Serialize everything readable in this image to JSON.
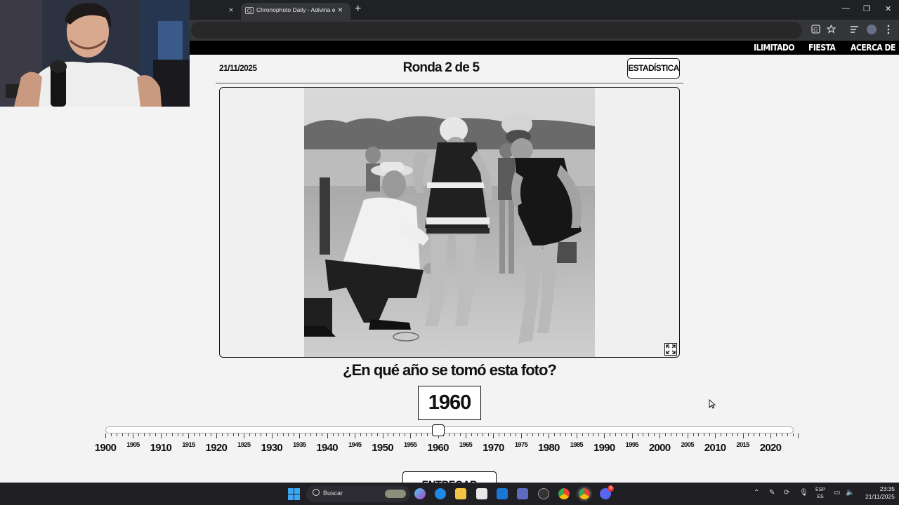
{
  "browser": {
    "tab_title": "Chronophoto Daily - Adivina el año",
    "tab_close": "×",
    "new_tab": "+",
    "window_controls": [
      "—",
      "❐",
      "✕"
    ]
  },
  "nav": {
    "items": [
      "ILIMITADO",
      "FIESTA",
      "ACERCA DE"
    ]
  },
  "header": {
    "date": "21/11/2025",
    "round": "Ronda 2 de 5",
    "stats_button": "ESTADÍSTICA"
  },
  "question": {
    "text": "¿En qué año se tomó esta foto?",
    "selected_year": "1960"
  },
  "slider": {
    "min": 1900,
    "max": 2025,
    "value": 1960,
    "major_labels": [
      "1900",
      "1910",
      "1920",
      "1930",
      "1940",
      "1950",
      "1960",
      "1970",
      "1980",
      "1990",
      "2000",
      "2010",
      "2020"
    ],
    "minor_labels": [
      "1905",
      "1915",
      "1925",
      "1935",
      "1945",
      "1955",
      "1965",
      "1975",
      "1985",
      "1995",
      "2005",
      "2015"
    ]
  },
  "submit_button": "ENTREGAR",
  "taskbar": {
    "search_label": "Buscar",
    "language": "ESP",
    "language_sub": "ES",
    "time": "23:35",
    "date": "21/11/2025",
    "notification_count": "6"
  }
}
